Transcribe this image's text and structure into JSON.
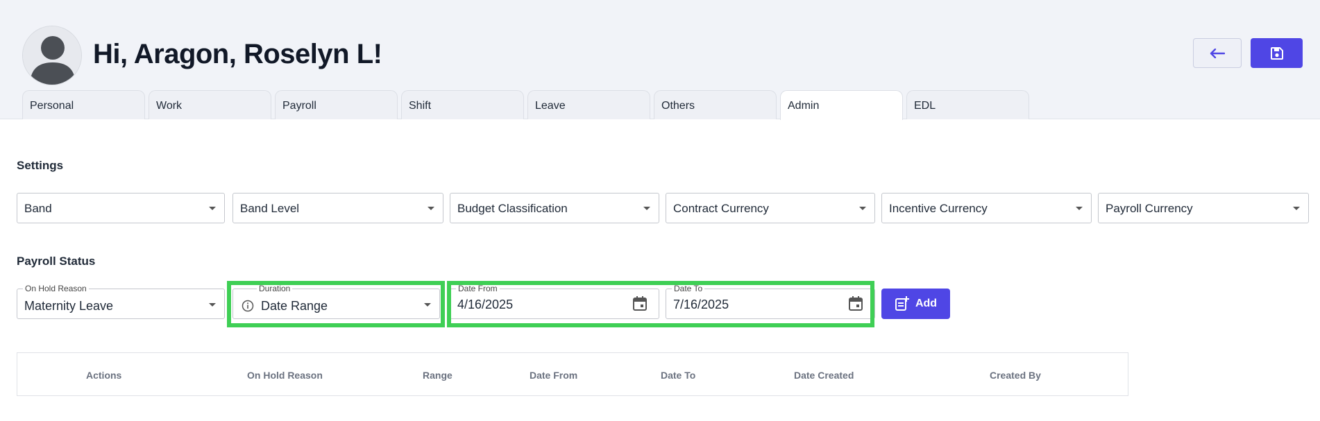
{
  "header": {
    "greeting": "Hi, Aragon, Roselyn L!"
  },
  "tabs": [
    {
      "label": "Personal"
    },
    {
      "label": "Work"
    },
    {
      "label": "Payroll"
    },
    {
      "label": "Shift"
    },
    {
      "label": "Leave"
    },
    {
      "label": "Others"
    },
    {
      "label": "Admin",
      "active": true
    },
    {
      "label": "EDL"
    }
  ],
  "settings": {
    "title": "Settings",
    "dropdowns": [
      {
        "label": "Band"
      },
      {
        "label": "Band Level"
      },
      {
        "label": "Budget Classification"
      },
      {
        "label": "Contract Currency"
      },
      {
        "label": "Incentive Currency"
      },
      {
        "label": "Payroll Currency"
      }
    ]
  },
  "payroll_status": {
    "title": "Payroll Status",
    "on_hold_reason": {
      "legend": "On Hold Reason",
      "value": "Maternity Leave"
    },
    "duration": {
      "legend": "Duration",
      "value": "Date Range"
    },
    "date_from": {
      "legend": "Date From",
      "value": "4/16/2025"
    },
    "date_to": {
      "legend": "Date To",
      "value": "7/16/2025"
    },
    "add_label": "Add"
  },
  "table": {
    "columns": [
      "Actions",
      "On Hold Reason",
      "Range",
      "Date From",
      "Date To",
      "Date Created",
      "Created By"
    ]
  },
  "colors": {
    "accent": "#4f46e5",
    "highlight": "#3fcf55",
    "header_bg": "#f1f3f8"
  },
  "icons": {
    "back": "arrow-left-icon",
    "save": "floppy-disk-icon",
    "add": "note-add-icon",
    "calendar": "calendar-icon",
    "info": "info-icon"
  }
}
